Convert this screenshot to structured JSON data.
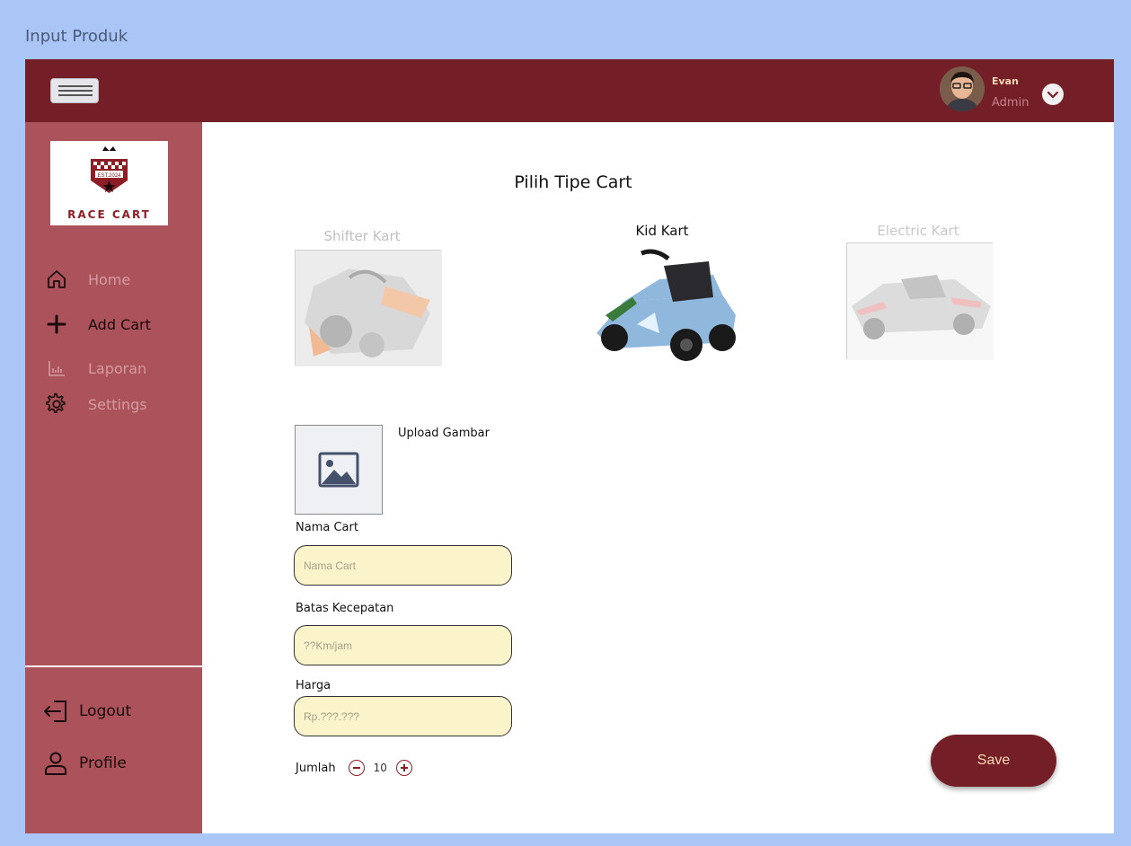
{
  "window": {
    "title": "Input Produk"
  },
  "topbar": {
    "user_name": "Evan",
    "user_role": "Admin"
  },
  "sidebar": {
    "logo": {
      "badge": "EST.2024",
      "text": "RACE CART"
    },
    "items": [
      {
        "label": "Home",
        "icon": "home-icon",
        "active": false
      },
      {
        "label": "Add Cart",
        "icon": "plus-icon",
        "active": true
      },
      {
        "label": "Laporan",
        "icon": "bar-chart-icon",
        "active": false
      },
      {
        "label": "Settings",
        "icon": "gear-icon",
        "active": false
      }
    ],
    "bottom": [
      {
        "label": "Logout",
        "icon": "logout-icon"
      },
      {
        "label": "Profile",
        "icon": "user-icon"
      }
    ]
  },
  "main": {
    "title": "Pilih Tipe Cart",
    "cart_types": [
      {
        "label": "Shifter Kart",
        "selected": false
      },
      {
        "label": "Kid Kart",
        "selected": true
      },
      {
        "label": "Electric Kart",
        "selected": false
      }
    ],
    "upload_label": "Upload Gambar",
    "fields": [
      {
        "label": "Nama Cart",
        "placeholder": "Nama Cart"
      },
      {
        "label": "Batas Kecepatan",
        "placeholder": "??Km/jam"
      },
      {
        "label": "Harga",
        "placeholder": "Rp.???.???"
      }
    ],
    "quantity": {
      "label": "Jumlah",
      "value": "10"
    },
    "save_label": "Save"
  },
  "colors": {
    "topbar": "#741e28",
    "sidebar": "#ab525b",
    "input_bg": "#fbf3c9",
    "frame_bg": "#a9c6f7"
  }
}
